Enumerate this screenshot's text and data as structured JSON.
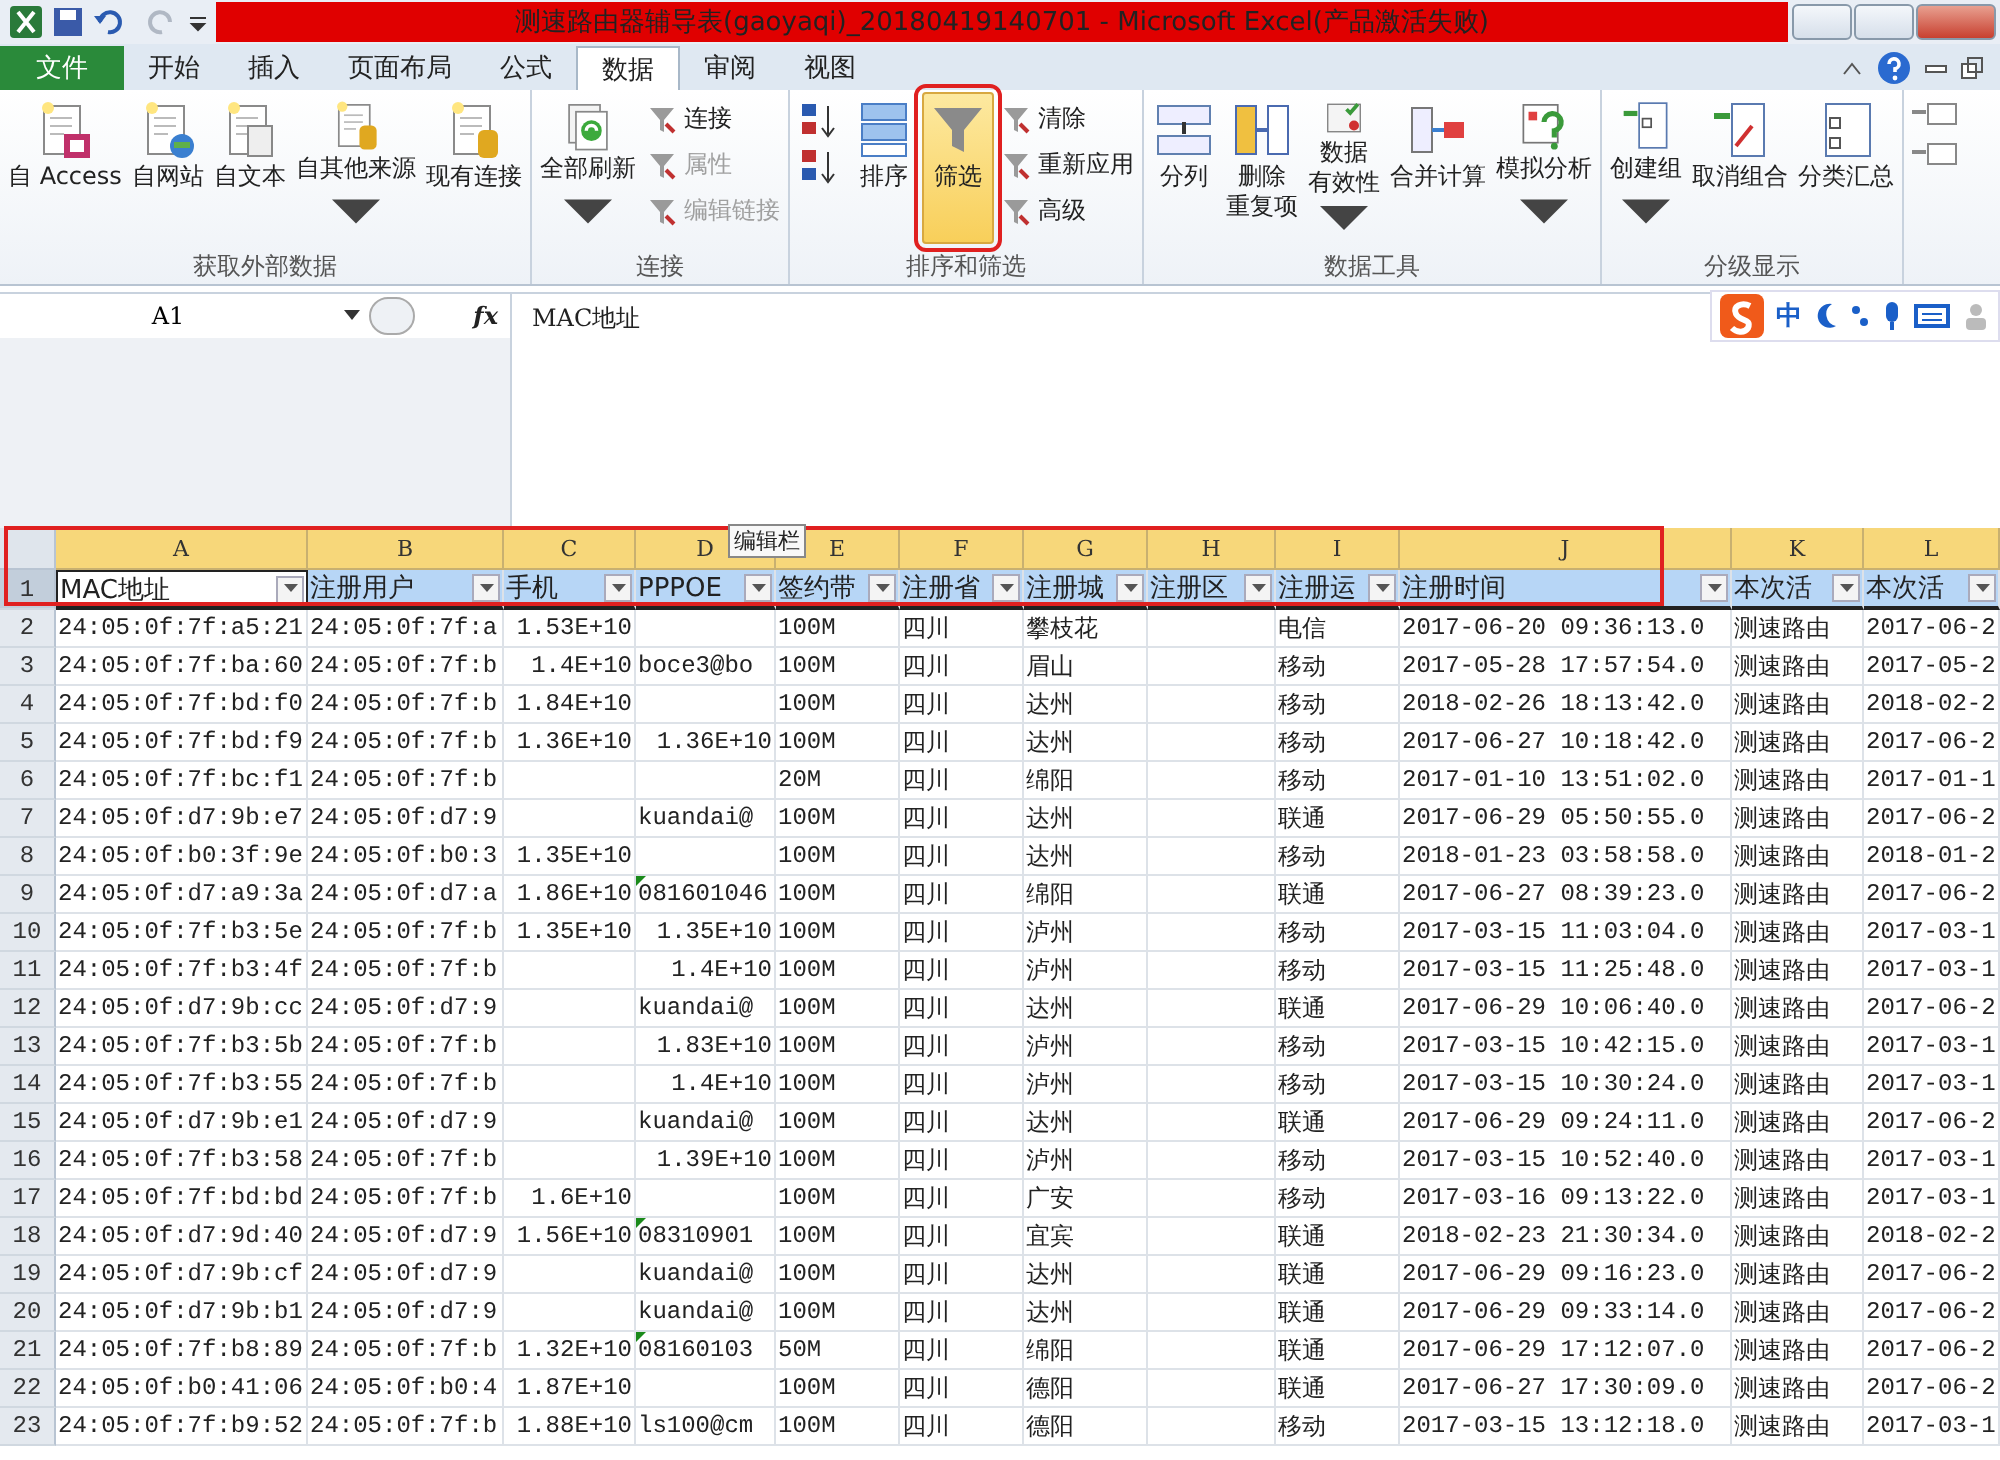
{
  "window": {
    "title": "测速路由器辅导表(gaoyaqi)_20180419140701 - Microsoft Excel(产品激活失败)"
  },
  "tabs": [
    {
      "label": "文件",
      "kind": "file",
      "selected": false
    },
    {
      "label": "开始",
      "kind": "tab",
      "selected": false
    },
    {
      "label": "插入",
      "kind": "tab",
      "selected": false
    },
    {
      "label": "页面布局",
      "kind": "tab",
      "selected": false
    },
    {
      "label": "公式",
      "kind": "tab",
      "selected": false
    },
    {
      "label": "数据",
      "kind": "tab",
      "selected": true
    },
    {
      "label": "审阅",
      "kind": "tab",
      "selected": false
    },
    {
      "label": "视图",
      "kind": "tab",
      "selected": false
    }
  ],
  "ribbon": {
    "groups": [
      {
        "label": "获取外部数据",
        "items": [
          {
            "kind": "large",
            "lines": [
              "自 Access"
            ]
          },
          {
            "kind": "large",
            "lines": [
              "自网站"
            ]
          },
          {
            "kind": "large",
            "lines": [
              "自文本"
            ]
          },
          {
            "kind": "large",
            "lines": [
              "自其他来源"
            ],
            "caret": true
          },
          {
            "kind": "large",
            "lines": [
              "现有连接"
            ]
          }
        ]
      },
      {
        "label": "连接",
        "items": [
          {
            "kind": "large",
            "lines": [
              "全部刷新"
            ],
            "caret": true
          },
          {
            "kind": "stack",
            "items": [
              {
                "kind": "command",
                "label": "连接",
                "disabled": false
              },
              {
                "kind": "command",
                "label": "属性",
                "disabled": true
              },
              {
                "kind": "command",
                "label": "编辑链接",
                "disabled": true
              }
            ]
          }
        ]
      },
      {
        "label": "排序和筛选",
        "items": [
          {
            "kind": "stack",
            "items": [
              {
                "kind": "ascending"
              },
              {
                "kind": "descending"
              }
            ]
          },
          {
            "kind": "large",
            "lines": [
              "排序"
            ]
          },
          {
            "kind": "large",
            "lines": [
              "筛选"
            ],
            "selected": true
          },
          {
            "kind": "stack",
            "items": [
              {
                "kind": "command",
                "label": "清除",
                "disabled": false
              },
              {
                "kind": "command",
                "label": "重新应用",
                "disabled": false
              },
              {
                "kind": "command",
                "label": "高级",
                "disabled": false
              }
            ]
          }
        ]
      },
      {
        "label": "数据工具",
        "items": [
          {
            "kind": "large",
            "lines": [
              "分列"
            ]
          },
          {
            "kind": "large",
            "lines": [
              "删除",
              "重复项"
            ]
          },
          {
            "kind": "large",
            "lines": [
              "数据",
              "有效性"
            ],
            "caret": true
          },
          {
            "kind": "large",
            "lines": [
              "合并计算"
            ]
          },
          {
            "kind": "large",
            "lines": [
              "模拟分析"
            ],
            "caret": true
          }
        ]
      },
      {
        "label": "分级显示",
        "items": [
          {
            "kind": "large",
            "lines": [
              "创建组"
            ],
            "caret": true
          },
          {
            "kind": "large",
            "lines": [
              "取消组合"
            ]
          },
          {
            "kind": "large",
            "lines": [
              "分类汇总"
            ]
          }
        ]
      }
    ]
  },
  "ime_toolbar": {
    "label": "中"
  },
  "formula_bar": {
    "name_box": "A1",
    "fx": "fx",
    "formula": "MAC地址"
  },
  "tooltip": "编辑栏",
  "sheet": {
    "columns": [
      "A",
      "B",
      "C",
      "D",
      "E",
      "F",
      "G",
      "H",
      "I",
      "J",
      "K",
      "L"
    ],
    "header": {
      "row": "1",
      "selected": true,
      "cells": [
        "MAC地址",
        "注册用户",
        "手机",
        "PPPOE",
        "签约带",
        "注册省",
        "注册城",
        "注册区",
        "注册运",
        "注册时间",
        "本次活",
        "本次活"
      ]
    },
    "rows": [
      {
        "row": "2",
        "cells": [
          "24:05:0f:7f:a5:21",
          "24:05:0f:7f:a",
          "1.53E+10",
          null,
          "100M",
          "四川",
          "攀枝花",
          null,
          "电信",
          "2017-06-20 09:36:13.0",
          "测速路由",
          "2017-06-2"
        ]
      },
      {
        "row": "3",
        "cells": [
          "24:05:0f:7f:ba:60",
          "24:05:0f:7f:b",
          "1.4E+10",
          "boce3@bo",
          "100M",
          "四川",
          "眉山",
          null,
          "移动",
          "2017-05-28 17:57:54.0",
          "测速路由",
          "2017-05-2"
        ]
      },
      {
        "row": "4",
        "cells": [
          "24:05:0f:7f:bd:f0",
          "24:05:0f:7f:b",
          "1.84E+10",
          null,
          "100M",
          "四川",
          "达州",
          null,
          "移动",
          "2018-02-26 18:13:42.0",
          "测速路由",
          "2018-02-2"
        ]
      },
      {
        "row": "5",
        "d_numeric": true,
        "cells": [
          "24:05:0f:7f:bd:f9",
          "24:05:0f:7f:b",
          "1.36E+10",
          "1.36E+10",
          "100M",
          "四川",
          "达州",
          null,
          "移动",
          "2017-06-27 10:18:42.0",
          "测速路由",
          "2017-06-2"
        ]
      },
      {
        "row": "6",
        "cells": [
          "24:05:0f:7f:bc:f1",
          "24:05:0f:7f:b",
          null,
          null,
          "20M",
          "四川",
          "绵阳",
          null,
          "移动",
          "2017-01-10 13:51:02.0",
          "测速路由",
          "2017-01-1"
        ]
      },
      {
        "row": "7",
        "cells": [
          "24:05:0f:d7:9b:e7",
          "24:05:0f:d7:9",
          null,
          "kuandai@",
          "100M",
          "四川",
          "达州",
          null,
          "联通",
          "2017-06-29 05:50:55.0",
          "测速路由",
          "2017-06-2"
        ]
      },
      {
        "row": "8",
        "cells": [
          "24:05:0f:b0:3f:9e",
          "24:05:0f:b0:3",
          "1.35E+10",
          null,
          "100M",
          "四川",
          "达州",
          null,
          "移动",
          "2018-01-23 03:58:58.0",
          "测速路由",
          "2018-01-2"
        ]
      },
      {
        "row": "9",
        "d_flag": true,
        "cells": [
          "24:05:0f:d7:a9:3a",
          "24:05:0f:d7:a",
          "1.86E+10",
          "081601046",
          "100M",
          "四川",
          "绵阳",
          null,
          "联通",
          "2017-06-27 08:39:23.0",
          "测速路由",
          "2017-06-2"
        ]
      },
      {
        "row": "10",
        "d_numeric": true,
        "cells": [
          "24:05:0f:7f:b3:5e",
          "24:05:0f:7f:b",
          "1.35E+10",
          "1.35E+10",
          "100M",
          "四川",
          "泸州",
          null,
          "移动",
          "2017-03-15 11:03:04.0",
          "测速路由",
          "2017-03-1"
        ]
      },
      {
        "row": "11",
        "d_numeric": true,
        "cells": [
          "24:05:0f:7f:b3:4f",
          "24:05:0f:7f:b",
          null,
          "1.4E+10",
          "100M",
          "四川",
          "泸州",
          null,
          "移动",
          "2017-03-15 11:25:48.0",
          "测速路由",
          "2017-03-1"
        ]
      },
      {
        "row": "12",
        "cells": [
          "24:05:0f:d7:9b:cc",
          "24:05:0f:d7:9",
          null,
          "kuandai@",
          "100M",
          "四川",
          "达州",
          null,
          "联通",
          "2017-06-29 10:06:40.0",
          "测速路由",
          "2017-06-2"
        ]
      },
      {
        "row": "13",
        "d_numeric": true,
        "cells": [
          "24:05:0f:7f:b3:5b",
          "24:05:0f:7f:b",
          null,
          "1.83E+10",
          "100M",
          "四川",
          "泸州",
          null,
          "移动",
          "2017-03-15 10:42:15.0",
          "测速路由",
          "2017-03-1"
        ]
      },
      {
        "row": "14",
        "d_numeric": true,
        "cells": [
          "24:05:0f:7f:b3:55",
          "24:05:0f:7f:b",
          null,
          "1.4E+10",
          "100M",
          "四川",
          "泸州",
          null,
          "移动",
          "2017-03-15 10:30:24.0",
          "测速路由",
          "2017-03-1"
        ]
      },
      {
        "row": "15",
        "cells": [
          "24:05:0f:d7:9b:e1",
          "24:05:0f:d7:9",
          null,
          "kuandai@",
          "100M",
          "四川",
          "达州",
          null,
          "联通",
          "2017-06-29 09:24:11.0",
          "测速路由",
          "2017-06-2"
        ]
      },
      {
        "row": "16",
        "d_numeric": true,
        "cells": [
          "24:05:0f:7f:b3:58",
          "24:05:0f:7f:b",
          null,
          "1.39E+10",
          "100M",
          "四川",
          "泸州",
          null,
          "移动",
          "2017-03-15 10:52:40.0",
          "测速路由",
          "2017-03-1"
        ]
      },
      {
        "row": "17",
        "cells": [
          "24:05:0f:7f:bd:bd",
          "24:05:0f:7f:b",
          "1.6E+10",
          null,
          "100M",
          "四川",
          "广安",
          null,
          "移动",
          "2017-03-16 09:13:22.0",
          "测速路由",
          "2017-03-1"
        ]
      },
      {
        "row": "18",
        "d_flag": true,
        "cells": [
          "24:05:0f:d7:9d:40",
          "24:05:0f:d7:9",
          "1.56E+10",
          "08310901",
          "100M",
          "四川",
          "宜宾",
          null,
          "联通",
          "2018-02-23 21:30:34.0",
          "测速路由",
          "2018-02-2"
        ]
      },
      {
        "row": "19",
        "cells": [
          "24:05:0f:d7:9b:cf",
          "24:05:0f:d7:9",
          null,
          "kuandai@",
          "100M",
          "四川",
          "达州",
          null,
          "联通",
          "2017-06-29 09:16:23.0",
          "测速路由",
          "2017-06-2"
        ]
      },
      {
        "row": "20",
        "cells": [
          "24:05:0f:d7:9b:b1",
          "24:05:0f:d7:9",
          null,
          "kuandai@",
          "100M",
          "四川",
          "达州",
          null,
          "联通",
          "2017-06-29 09:33:14.0",
          "测速路由",
          "2017-06-2"
        ]
      },
      {
        "row": "21",
        "d_flag": true,
        "cells": [
          "24:05:0f:7f:b8:89",
          "24:05:0f:7f:b",
          "1.32E+10",
          "08160103",
          "50M",
          "四川",
          "绵阳",
          null,
          "联通",
          "2017-06-29 17:12:07.0",
          "测速路由",
          "2017-06-2"
        ]
      },
      {
        "row": "22",
        "cells": [
          "24:05:0f:b0:41:06",
          "24:05:0f:b0:4",
          "1.87E+10",
          null,
          "100M",
          "四川",
          "德阳",
          null,
          "联通",
          "2017-06-27 17:30:09.0",
          "测速路由",
          "2017-06-2"
        ]
      },
      {
        "row": "23",
        "cells": [
          "24:05:0f:7f:b9:52",
          "24:05:0f:7f:b",
          "1.88E+10",
          "ls100@cm",
          "100M",
          "四川",
          "德阳",
          null,
          "移动",
          "2017-03-15 13:12:18.0",
          "测速路由",
          "2017-03-1"
        ]
      }
    ]
  }
}
